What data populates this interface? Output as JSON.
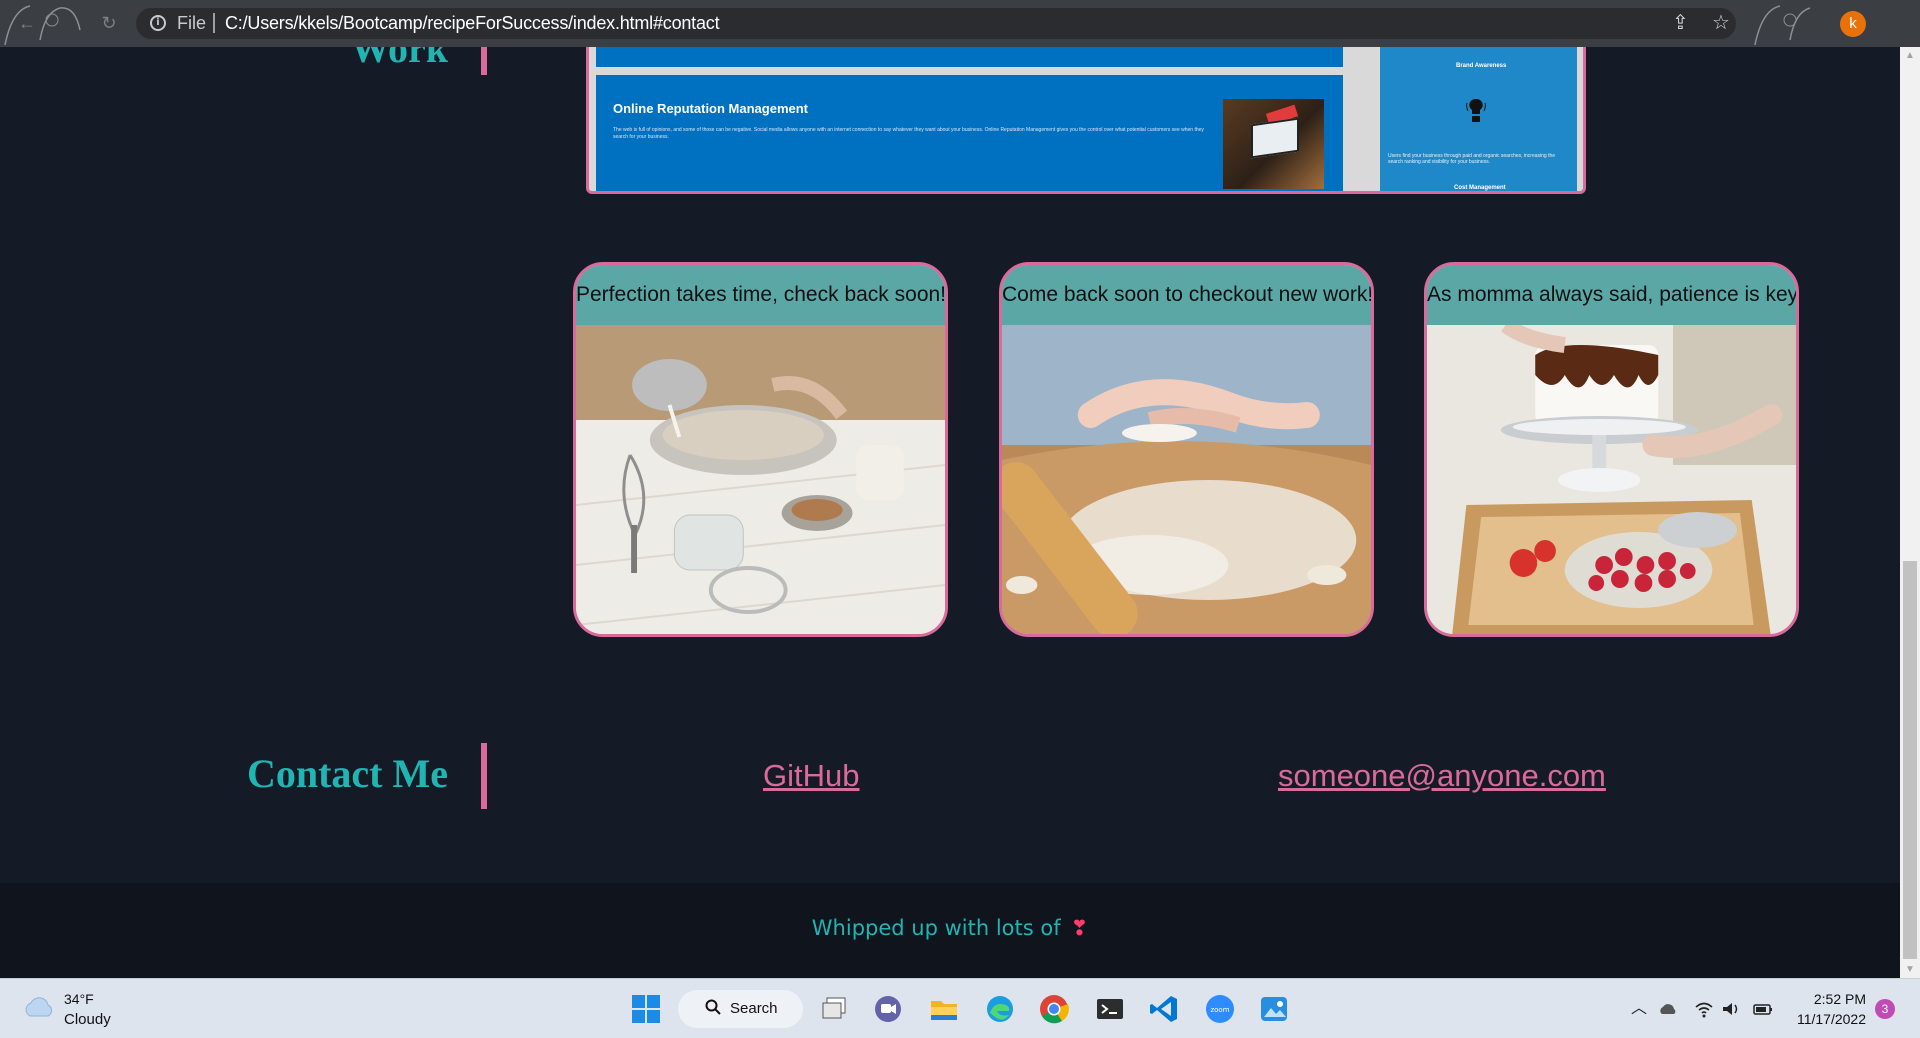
{
  "browser": {
    "file_label": "File",
    "url": "C:/Users/kkels/Bootcamp/recipeForSuccess/index.html#contact",
    "profile_initial": "k"
  },
  "work_section": {
    "heading": "Work",
    "project_preview": {
      "title": "Online Reputation Management",
      "body": "The web is full of opinions, and some of those can be negative. Social media allows anyone with an internet connection to say whatever they want about your business. Online Reputation Management gives you the control over what potential customers see when they search for your business.",
      "side_title": "Brand Awareness",
      "side_body": "Users find your business through paid and organic searches, increasing the search ranking and visibility for your business.",
      "side_footer": "Cost Management"
    },
    "cards": [
      {
        "caption": "Perfection takes time, check back soon!",
        "photo": "mixing-bowl-photo"
      },
      {
        "caption": "Come back soon to checkout new work!",
        "photo": "rolling-dough-photo"
      },
      {
        "caption": "As momma always said, patience is key!",
        "photo": "cake-decorating-photo"
      }
    ]
  },
  "contact_section": {
    "heading": "Contact Me",
    "github_label": "GitHub",
    "email_label": "someone@anyone.com"
  },
  "footer": {
    "text": "Whipped up with lots of",
    "heart": "❣"
  },
  "taskbar": {
    "weather_temp": "34°F",
    "weather_desc": "Cloudy",
    "search_label": "Search",
    "apps": [
      "start-icon",
      "task-view-icon",
      "teams-chat-icon",
      "file-explorer-icon",
      "edge-icon",
      "chrome-icon",
      "terminal-icon",
      "vscode-icon",
      "zoom-icon",
      "photos-icon"
    ],
    "time": "2:52 PM",
    "date": "11/17/2022",
    "notifications": "3"
  },
  "colors": {
    "accent_teal": "#20b4b2",
    "accent_pink": "#d96a99",
    "page_bg": "#151b26",
    "caption_bg": "#5ba7a6"
  }
}
